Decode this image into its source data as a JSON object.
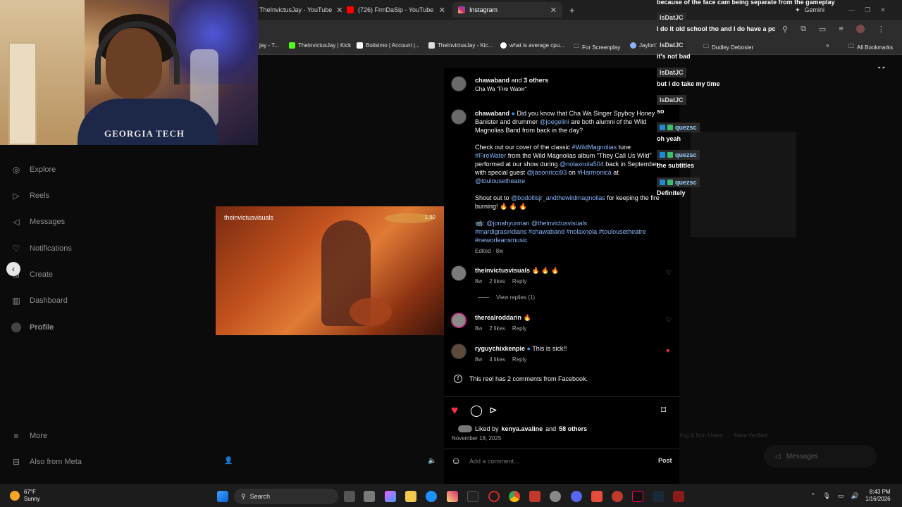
{
  "browser": {
    "tabs": [
      {
        "label": "TheInvictusJay - YouTube"
      },
      {
        "label": "(726) FrmDaSip - YouTube"
      },
      {
        "label": "Instagram"
      }
    ],
    "new_tab": "+",
    "bookmarks": [
      {
        "label": "jay - T..."
      },
      {
        "label": "TheInvictusJay | Kick"
      },
      {
        "label": "Botisimo | Account |..."
      },
      {
        "label": "TheInvictusJay - Kic..."
      },
      {
        "label": "what is average cpu..."
      },
      {
        "label": "For Screenplay"
      },
      {
        "label": "Jaylon's"
      },
      {
        "label": "Dudley Debosier"
      },
      {
        "label": "»"
      },
      {
        "label": "All Bookmarks"
      }
    ],
    "gemini_label": "Gemini"
  },
  "webcam": {
    "shirt_text": "GEORGIA TECH"
  },
  "sidebar": {
    "items": [
      {
        "label": "Explore",
        "icon": "compass-icon"
      },
      {
        "label": "Reels",
        "icon": "reels-icon"
      },
      {
        "label": "Messages",
        "icon": "messages-icon"
      },
      {
        "label": "Notifications",
        "icon": "heart-icon"
      },
      {
        "label": "Create",
        "icon": "plus-icon"
      },
      {
        "label": "Dashboard",
        "icon": "dashboard-icon"
      },
      {
        "label": "Profile",
        "icon": "avatar-icon"
      }
    ],
    "more": "More",
    "meta": "Also from Meta"
  },
  "video": {
    "author": "theinvictusvisuals",
    "duration": "1:30"
  },
  "post": {
    "header_user": "chawaband",
    "header_and": "and",
    "header_others": "3 others",
    "header_sub": "Cha Wa \"Fire Water\"",
    "caption_user": "chawaband",
    "caption_p1a": "Did you know that Cha Wa Singer Spyboy Honey Banister and drummer ",
    "caption_p1_link": "@joegelini",
    "caption_p1b": " are both alumni of the Wild Magnolias Band from back in the day?",
    "caption_p2a": "Check out our cover of the classic ",
    "caption_p2_link1": "#WildMagnolias",
    "caption_p2b": " tune ",
    "caption_p2_link2": "#FireWater",
    "caption_p2c": " from the Wild Magnolias album \"They Call Us Wild\" performed at our show during ",
    "caption_p2_link3": "@nolaxnola504",
    "caption_p2d": " back in September with special guest ",
    "caption_p2_link4": "@jasonricci93",
    "caption_p2e": " on ",
    "caption_p2_link5": "#Harmonica",
    "caption_p2f": " at ",
    "caption_p2_link6": "@toulousetheatre",
    "caption_p3a": "Shout out to ",
    "caption_p3_link": "@bodollisjr_andthewildmagnolias",
    "caption_p3b": " for keeping the fire burning! 🔥 🔥 🔥",
    "caption_p4_emoji": "📹: ",
    "caption_p4_links": "@jonahyurman @theinvictusvisuals",
    "caption_p5_tags": "#mardigrasindians #chawaband #nolaxnola #toulousetheatre #neworleansmusic",
    "edited": "Edited · 8w",
    "comments": [
      {
        "user": "theinvictusvisuals",
        "text": "🔥 🔥 🔥",
        "age": "8w",
        "likes": "2 likes",
        "reply": "Reply",
        "liked": false
      },
      {
        "user": "therealroddarin",
        "text": "🔥",
        "age": "8w",
        "likes": "2 likes",
        "reply": "Reply",
        "liked": false
      },
      {
        "user": "ryguychixkenpie",
        "text": "This is sick!!",
        "age": "8w",
        "likes": "4 likes",
        "reply": "Reply",
        "liked": true
      }
    ],
    "view_replies": "View replies (1)",
    "facebook_note": "This reel has 2 comments from Facebook.",
    "liked_by_prefix": "Liked by",
    "liked_by_user": "kenya.avaline",
    "liked_by_and": "and",
    "liked_by_count": "58 others",
    "date": "November 18, 2025",
    "comment_placeholder": "Add a comment...",
    "post_button": "Post"
  },
  "chat": [
    {
      "type": "msg",
      "text": "because of the face cam being separate from the gameplay"
    },
    {
      "type": "user",
      "name": "IsDatJC"
    },
    {
      "type": "msg",
      "text": "I do it old school tho and I do have a pc"
    },
    {
      "type": "user",
      "name": "IsDatJC"
    },
    {
      "type": "msg",
      "text": "it's not bad"
    },
    {
      "type": "user",
      "name": "IsDatJC"
    },
    {
      "type": "msg",
      "text": "but I do take my time"
    },
    {
      "type": "user",
      "name": "IsDatJC"
    },
    {
      "type": "msg",
      "text": "so"
    },
    {
      "type": "user",
      "name": "quezsc"
    },
    {
      "type": "msg",
      "text": "oh yeah"
    },
    {
      "type": "user",
      "name": "quezsc"
    },
    {
      "type": "msg",
      "text": "the subtitles"
    },
    {
      "type": "user",
      "name": "quezsc"
    },
    {
      "type": "msg",
      "text": "Definitely"
    }
  ],
  "right_area": {
    "footer_a": "ading & Non-Users",
    "footer_b": "Meta Verified",
    "messages": "Messages"
  },
  "taskbar": {
    "weather_temp": "67°F",
    "weather_desc": "Sunny",
    "search": "Search",
    "time": "8:43 PM",
    "date": "1/16/2026"
  },
  "colors": {
    "accent_blue": "#8ab4f8",
    "heart_red": "#ff3040",
    "chat_user_bg": "#2a2a2a"
  }
}
